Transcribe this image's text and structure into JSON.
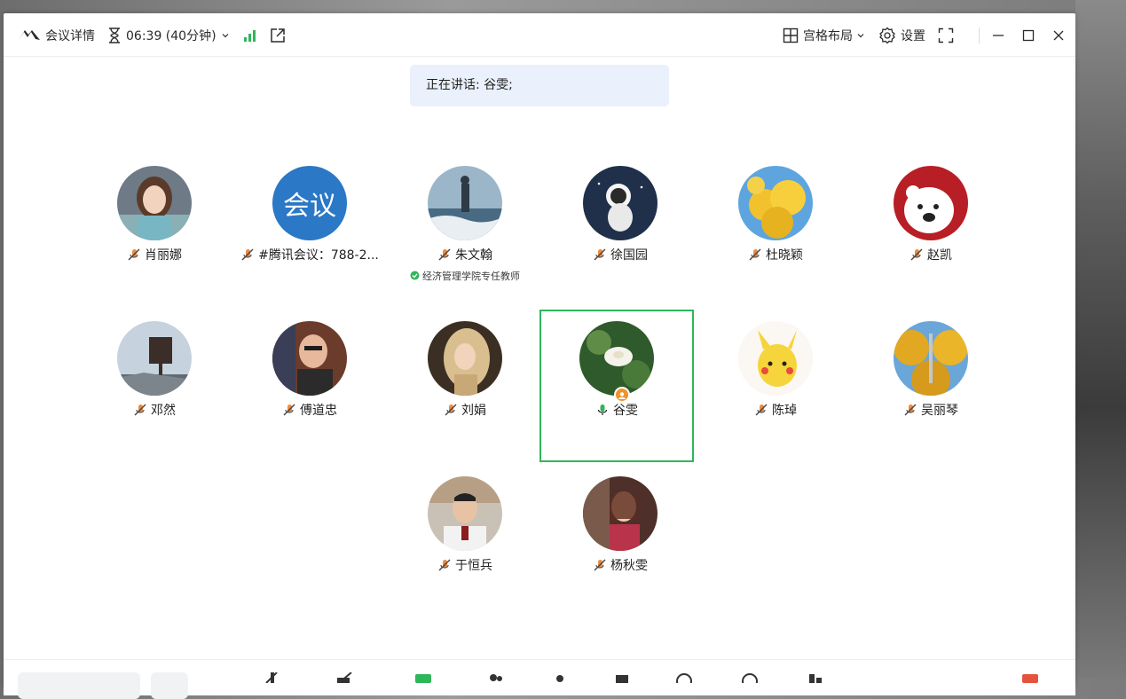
{
  "colors": {
    "accent_green": "#2fb65a",
    "speaking_bg": "#eaf1fc",
    "badge_orange": "#f0932b"
  },
  "titlebar": {
    "meeting_details": "会议详情",
    "timer": "06:39 (40分钟)",
    "layout_label": "宫格布局",
    "settings_label": "设置"
  },
  "speaking_banner": "正在讲话: 谷雯;",
  "participants": [
    {
      "name": "肖丽娜",
      "muted": true,
      "avatar": "photo"
    },
    {
      "name": "#腾讯会议：788-2...",
      "muted": true,
      "avatar": "text",
      "avatar_text": "会议"
    },
    {
      "name": "朱文翰",
      "muted": true,
      "avatar": "photo",
      "subtitle": "经济管理学院专任教师"
    },
    {
      "name": "徐国园",
      "muted": true,
      "avatar": "photo"
    },
    {
      "name": "杜晓颖",
      "muted": true,
      "avatar": "photo"
    },
    {
      "name": "赵凯",
      "muted": true,
      "avatar": "photo"
    },
    {
      "name": "邓然",
      "muted": true,
      "avatar": "photo"
    },
    {
      "name": "傅道忠",
      "muted": true,
      "avatar": "photo"
    },
    {
      "name": "刘娟",
      "muted": true,
      "avatar": "photo"
    },
    {
      "name": "谷雯",
      "muted": false,
      "avatar": "photo",
      "speaking": true
    },
    {
      "name": "陈琸",
      "muted": true,
      "avatar": "photo"
    },
    {
      "name": "吴丽琴",
      "muted": true,
      "avatar": "photo"
    },
    {
      "name": "于恒兵",
      "muted": true,
      "avatar": "photo"
    },
    {
      "name": "杨秋雯",
      "muted": true,
      "avatar": "photo"
    }
  ]
}
